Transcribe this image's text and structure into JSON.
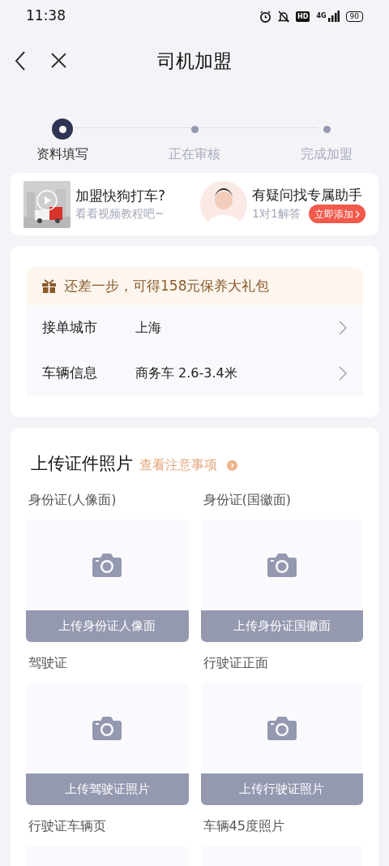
{
  "status_bar": {
    "time": "11:38",
    "battery": "90",
    "network": "4G",
    "hd": "HD"
  },
  "header": {
    "title": "司机加盟"
  },
  "steps": [
    {
      "label": "资料填写",
      "selected": true
    },
    {
      "label": "正在审核",
      "selected": false
    },
    {
      "label": "完成加盟",
      "selected": false
    }
  ],
  "promos": [
    {
      "kind": "video",
      "title": "加盟快狗打车?",
      "subtitle": "看看视频教程吧~"
    },
    {
      "kind": "assistant",
      "title": "有疑问找专属助手",
      "subtitle": "1对1解答",
      "button": "立即添加"
    }
  ],
  "reward_banner": {
    "text": "还差一步，可得158元保养大礼包"
  },
  "info_rows": [
    {
      "label": "接单城市",
      "value": "上海"
    },
    {
      "label": "车辆信息",
      "value": "商务车 2.6-3.4米"
    }
  ],
  "upload_section": {
    "title": "上传证件照片",
    "link": "查看注意事项",
    "items": [
      {
        "label": "身份证(人像面)",
        "button": "上传身份证人像面"
      },
      {
        "label": "身份证(国徽面)",
        "button": "上传身份证国徽面"
      },
      {
        "label": "驾驶证",
        "button": "上传驾驶证照片"
      },
      {
        "label": "行驶证正面",
        "button": "上传行驶证照片"
      },
      {
        "label": "行驶证车辆页"
      },
      {
        "label": "车辆45度照片"
      }
    ]
  }
}
